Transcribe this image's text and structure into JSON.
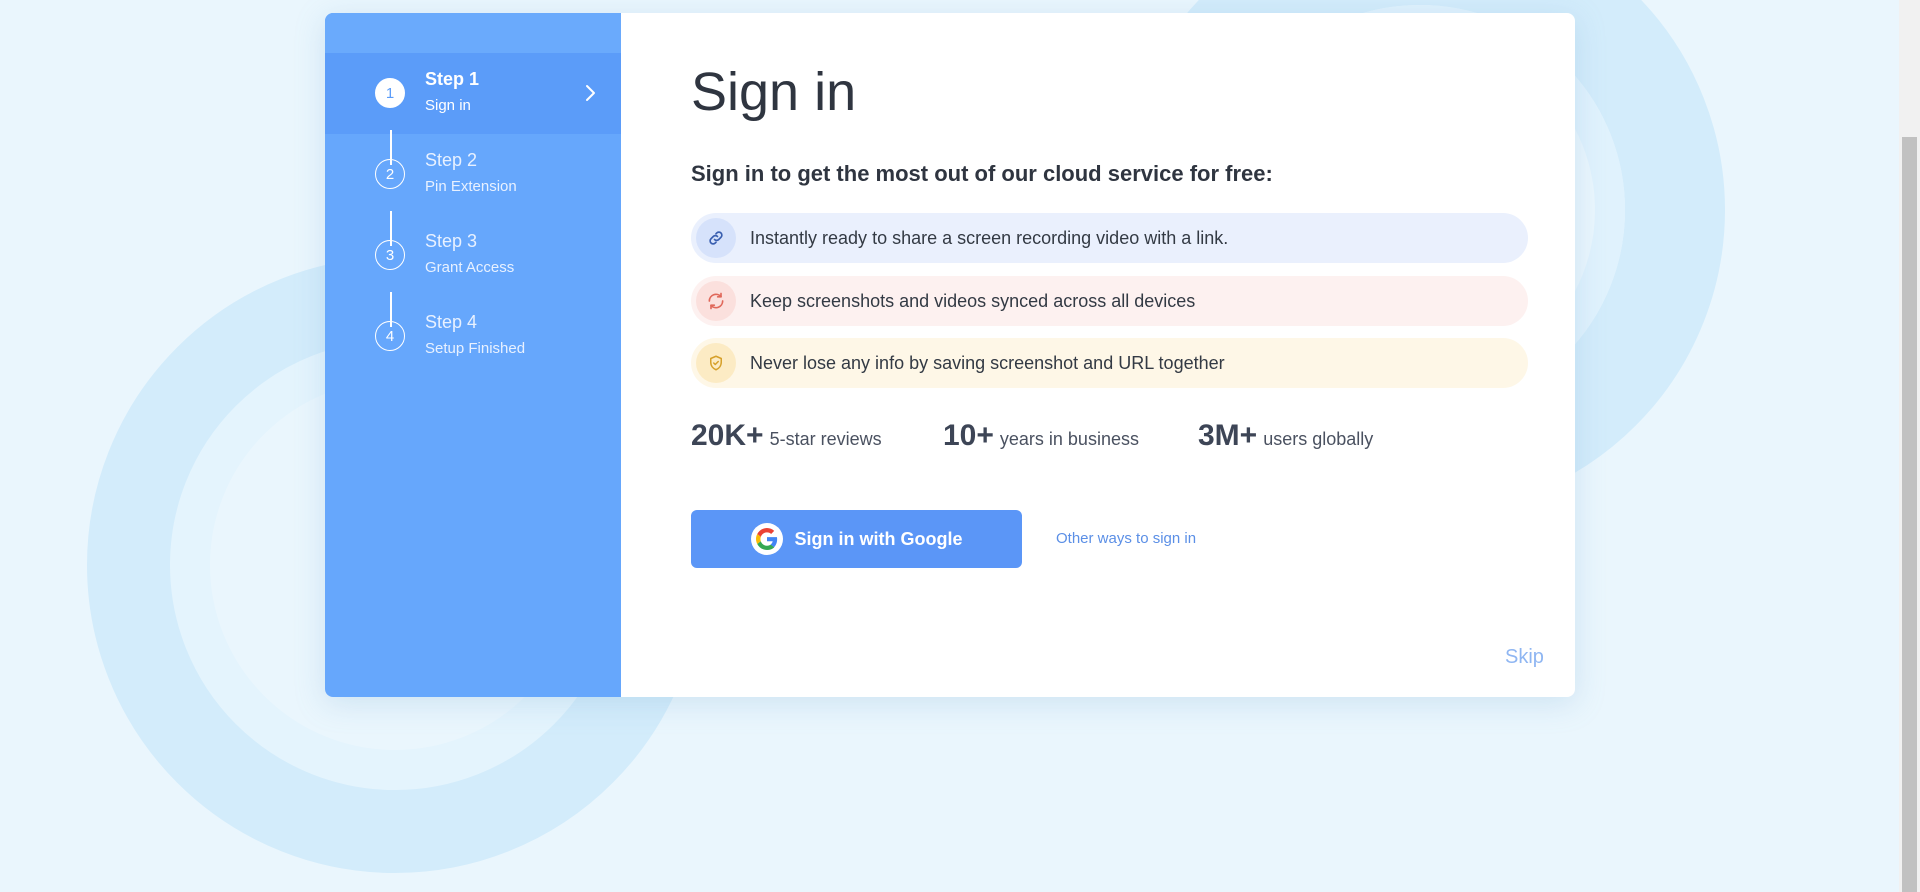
{
  "colors": {
    "page_bg": "#eaf6fd",
    "sidebar_bg": "#66a7fc",
    "sidebar_active": "#5b9cf9",
    "primary_button": "#5b96f7",
    "link": "#5b8fe6",
    "skip": "#8fb6f2",
    "feature_blue_bg": "#eaf0fd",
    "feature_red_bg": "#fdf1f0",
    "feature_yellow_bg": "#fef7e7"
  },
  "sidebar": {
    "steps": [
      {
        "number": "1",
        "title": "Step 1",
        "subtitle": "Sign in",
        "active": true
      },
      {
        "number": "2",
        "title": "Step 2",
        "subtitle": "Pin Extension",
        "active": false
      },
      {
        "number": "3",
        "title": "Step 3",
        "subtitle": "Grant Access",
        "active": false
      },
      {
        "number": "4",
        "title": "Step 4",
        "subtitle": "Setup Finished",
        "active": false
      }
    ]
  },
  "main": {
    "title": "Sign in",
    "subtitle": "Sign in to get the most out of our cloud service for free:",
    "features": [
      {
        "icon": "link-icon",
        "text": "Instantly ready to share a screen recording video with a link."
      },
      {
        "icon": "sync-icon",
        "text": "Keep screenshots and videos synced across all devices"
      },
      {
        "icon": "shield-check-icon",
        "text": "Never lose any info by saving screenshot and URL together"
      }
    ],
    "stats": [
      {
        "value": "20K+",
        "label": "5-star reviews"
      },
      {
        "value": "10+",
        "label": "years in business"
      },
      {
        "value": "3M+",
        "label": "users globally"
      }
    ],
    "google_button_label": "Sign in with Google",
    "other_ways_label": "Other ways to sign in",
    "skip_label": "Skip"
  }
}
